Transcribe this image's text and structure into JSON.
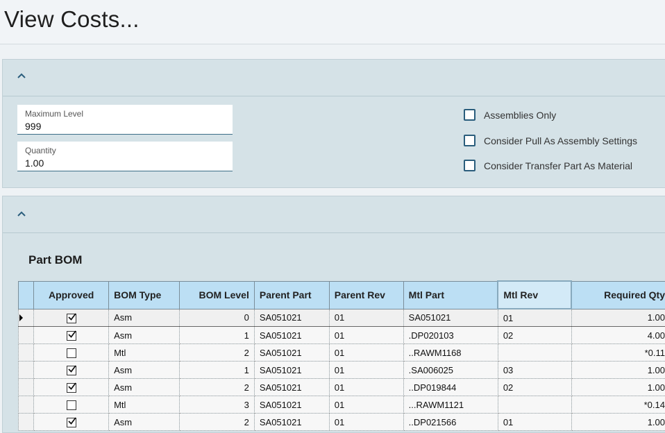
{
  "page": {
    "title": "View Costs..."
  },
  "settings": {
    "max_level": {
      "label": "Maximum Level",
      "value": "999"
    },
    "quantity": {
      "label": "Quantity",
      "value": "1.00"
    },
    "checkboxes": [
      {
        "label": "Assemblies Only",
        "checked": false
      },
      {
        "label": "Consider Pull As Assembly Settings",
        "checked": false
      },
      {
        "label": "Consider Transfer Part As Material",
        "checked": false
      }
    ]
  },
  "bom": {
    "title": "Part BOM",
    "columns": [
      "Approved",
      "BOM Type",
      "BOM Level",
      "Parent Part",
      "Parent Rev",
      "Mtl Part",
      "Mtl Rev",
      "Required Qty"
    ],
    "rows": [
      {
        "approved": true,
        "bom_type": "Asm",
        "bom_level": "0",
        "parent_part": "SA051021",
        "parent_rev": "01",
        "mtl_part": "SA051021",
        "mtl_rev": "01",
        "required_qty": "1.00"
      },
      {
        "approved": true,
        "bom_type": "Asm",
        "bom_level": "1",
        "parent_part": "SA051021",
        "parent_rev": "01",
        "mtl_part": ".DP020103",
        "mtl_rev": "02",
        "required_qty": "4.00"
      },
      {
        "approved": false,
        "bom_type": "Mtl",
        "bom_level": "2",
        "parent_part": "SA051021",
        "parent_rev": "01",
        "mtl_part": "..RAWM1168",
        "mtl_rev": "",
        "required_qty": "*0.11"
      },
      {
        "approved": true,
        "bom_type": "Asm",
        "bom_level": "1",
        "parent_part": "SA051021",
        "parent_rev": "01",
        "mtl_part": ".SA006025",
        "mtl_rev": "03",
        "required_qty": "1.00"
      },
      {
        "approved": true,
        "bom_type": "Asm",
        "bom_level": "2",
        "parent_part": "SA051021",
        "parent_rev": "01",
        "mtl_part": "..DP019844",
        "mtl_rev": "02",
        "required_qty": "1.00"
      },
      {
        "approved": false,
        "bom_type": "Mtl",
        "bom_level": "3",
        "parent_part": "SA051021",
        "parent_rev": "01",
        "mtl_part": "...RAWM1121",
        "mtl_rev": "",
        "required_qty": "*0.14"
      },
      {
        "approved": true,
        "bom_type": "Asm",
        "bom_level": "2",
        "parent_part": "SA051021",
        "parent_rev": "01",
        "mtl_part": "..DP021566",
        "mtl_rev": "01",
        "required_qty": "1.00"
      }
    ]
  },
  "colors": {
    "accent": "#2a5d7c",
    "header_bg": "#bcdff4",
    "panel_bg": "#d5e2e7"
  },
  "icons": {
    "collapse": "chevron-up-icon",
    "row_indicator": "row-pointer-icon",
    "check": "checkmark-icon"
  }
}
